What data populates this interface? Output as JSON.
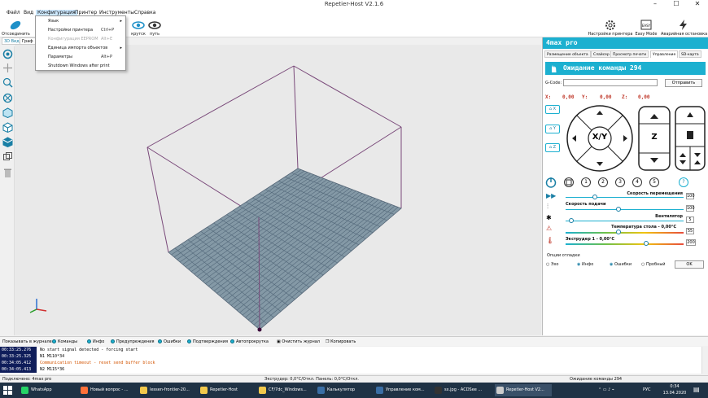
{
  "window": {
    "title": "Repetier-Host V2.1.6",
    "minimize": "–",
    "maximize": "☐",
    "close": "✕"
  },
  "menu": [
    "Файл",
    "Вид",
    "Конфигурация",
    "Принтер",
    "Инструменты",
    "Справка"
  ],
  "toolbar": {
    "left": [
      "Отсоединить"
    ],
    "middle": [
      "крутск",
      "путь"
    ],
    "right": [
      "Настройки принтера",
      "Easy Mode",
      "Аварийная остановка"
    ]
  },
  "dropdown": [
    {
      "label": "Язык",
      "shortcut": "",
      "submenu": true,
      "disabled": false
    },
    {
      "label": "Настройки принтера",
      "shortcut": "Ctrl+P",
      "submenu": false,
      "disabled": false
    },
    {
      "label": "Конфигурация EEPROM",
      "shortcut": "Alt+E",
      "submenu": false,
      "disabled": true
    },
    {
      "label": "Единица импорта объектов",
      "shortcut": "",
      "submenu": true,
      "disabled": false
    },
    {
      "label": "Параметры",
      "shortcut": "Alt+P",
      "submenu": false,
      "disabled": false
    },
    {
      "label": "Shutdown Windows after print",
      "shortcut": "",
      "submenu": false,
      "disabled": false
    }
  ],
  "view_tabs": [
    "3D Вид",
    "Граф"
  ],
  "left_tools": [
    "camera-icon",
    "move-icon",
    "zoom-icon",
    "fit-icon",
    "iso-view-icon",
    "front-view-icon",
    "top-view-icon",
    "side-view-icon",
    "clear-icon"
  ],
  "right_panel": {
    "printer_name": "4max pro",
    "tabs": [
      "Размещение объекта",
      "Слайсер",
      "Просмотр печати",
      "Управление",
      "SD-карта"
    ],
    "selected_tab": "Управление",
    "status": "Ожидание команды 294",
    "gcode_label": "G-Code:",
    "gcode_value": "",
    "send_button": "Отправить",
    "coords": {
      "x_label": "X:",
      "x": "0,00",
      "y_label": "Y:",
      "y": "0,00",
      "z_label": "Z:",
      "z": "0,00"
    },
    "home_buttons": [
      "X",
      "Y",
      "Z"
    ],
    "jog": {
      "xy": "X/Y",
      "z": "Z"
    },
    "extruder_buttons": [
      "1",
      "2",
      "3",
      "4",
      "5",
      "?"
    ],
    "sliders": [
      {
        "label": "Скорость перемещения",
        "value": "100",
        "level": 0.25
      },
      {
        "label": "Скорость подачи",
        "value": "100",
        "level": 0.45
      },
      {
        "label": "Вентилятор",
        "value": "5",
        "level": 0.05
      },
      {
        "label": "Температура стола - 0,00°C",
        "value": "55",
        "level": 0.45
      },
      {
        "label": "Экструдер 1 - 0,00°C",
        "value": "200",
        "level": 0.68
      }
    ],
    "debug": {
      "title": "Опции отладки",
      "options": [
        "Эхо",
        "Инфо",
        "Ошибки",
        "Пробный"
      ],
      "checked": [
        false,
        true,
        true,
        false
      ],
      "ok": "OK"
    }
  },
  "logbar": {
    "show_label": "Показывать в журнале:",
    "filters": [
      "Команды",
      "Инфо",
      "Предупреждения",
      "Ошибки",
      "Подтверждения",
      "Автопрокрутка"
    ],
    "clear": "Очистить журнал",
    "copy": "Копировать"
  },
  "log": [
    {
      "time": "00:33:25.276",
      "msg": "No start signal detected - forcing start",
      "color": "#000000"
    },
    {
      "time": "00:33:25.325",
      "msg": "N1 M110*34",
      "color": "#000000"
    },
    {
      "time": "00:34:05.412",
      "msg": "Communication timeout - reset send buffer block",
      "color": "#d35400"
    },
    {
      "time": "00:34:05.413",
      "msg": "N2 M115*36",
      "color": "#000000"
    }
  ],
  "statusbar": {
    "left": "Подключено: 4max pro",
    "middle": "Экструдер: 0,0°C/Откл. Панель: 0,0°C/Откл.",
    "right": "Ожидание команды 294"
  },
  "taskbar": {
    "apps": [
      {
        "label": "WhatsApp",
        "color": "#25d366"
      },
      {
        "label": "Новый вопрос - ...",
        "color": "#ff7139"
      },
      {
        "label": "Iessen-frontier-20...",
        "color": "#f2c94c"
      },
      {
        "label": "Repetier-Host",
        "color": "#f2c94c"
      },
      {
        "label": "CF/7dc_Windows...",
        "color": "#f2c94c"
      },
      {
        "label": "Калькулятор",
        "color": "#3a6ea5"
      },
      {
        "label": "Управление ком...",
        "color": "#3a6ea5"
      },
      {
        "label": "sx.jpg - ACDSee ...",
        "color": "#333333"
      },
      {
        "label": "Repetier-Host V2...",
        "color": "#cccccc"
      }
    ],
    "lang": "РУС",
    "time": "0:34",
    "date": "13.04.2020"
  },
  "colors": {
    "accent": "#1cb0d0",
    "log_time_bg": "#0f1d5a",
    "grid": "#5d7282"
  }
}
